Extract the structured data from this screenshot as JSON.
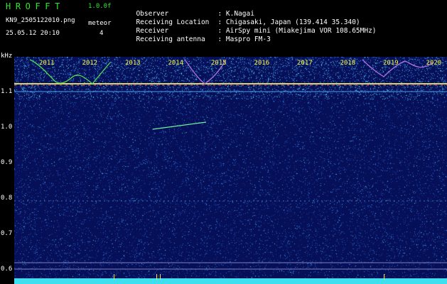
{
  "header": {
    "app_title": "HROFFT",
    "version": "1.0.0f",
    "filename": "KN9_2505122010.png",
    "meteor_label": "meteor",
    "datetime": "25.05.12 20:10",
    "meteor_count": "4"
  },
  "info": {
    "observer_label": "Observer",
    "observer_value": ": K.Nagai",
    "location_label": "Receiving Location",
    "location_value": ": Chigasaki, Japan (139.414 35.340)",
    "receiver_label": "Receiver",
    "receiver_value": ": AirSpy mini (Miakejima VOR 108.65MHz)",
    "antenna_label": "Receiving antenna",
    "antenna_value": ": Maspro FM-3"
  },
  "axis": {
    "unit": "kHz",
    "ticks": [
      {
        "label": "1.1",
        "value": 1.1
      },
      {
        "label": "1.0",
        "value": 1.0
      },
      {
        "label": "0.9",
        "value": 0.9
      },
      {
        "label": "0.8",
        "value": 0.8
      },
      {
        "label": "0.7",
        "value": 0.7
      },
      {
        "label": "0.6",
        "value": 0.6
      }
    ]
  },
  "years": [
    "2011",
    "2012",
    "2013",
    "2014",
    "2015",
    "2016",
    "2017",
    "2018",
    "2019",
    "2020"
  ],
  "colors": {
    "title_green": "#2ee82e",
    "background": "#061058",
    "carrier_line": "#d8d06a",
    "baseline_cyan": "#3ee0f0",
    "year_label": "#ffff40"
  }
}
